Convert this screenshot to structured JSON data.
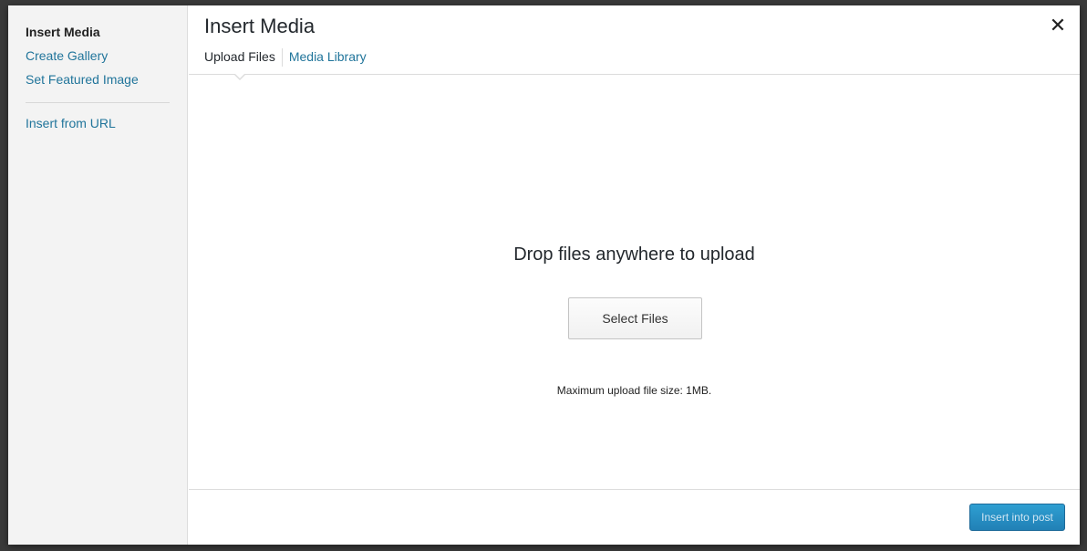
{
  "sidebar": {
    "items": [
      {
        "label": "Insert Media"
      },
      {
        "label": "Create Gallery"
      },
      {
        "label": "Set Featured Image"
      },
      {
        "label": "Insert from URL"
      }
    ]
  },
  "frame": {
    "title": "Insert Media",
    "close_icon": "close-icon",
    "tabs": [
      {
        "label": "Upload Files"
      },
      {
        "label": "Media Library"
      }
    ]
  },
  "uploader": {
    "drop_text": "Drop files anywhere to upload",
    "select_label": "Select Files",
    "max_size": "Maximum upload file size: 1MB."
  },
  "toolbar": {
    "insert_label": "Insert into post"
  },
  "colors": {
    "link": "#21759b",
    "primary_button": "#2e9fd2"
  }
}
